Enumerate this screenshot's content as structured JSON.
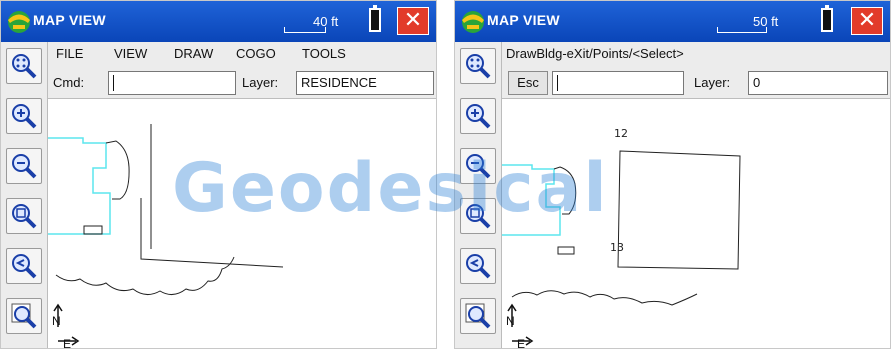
{
  "left": {
    "title": "MAP VIEW",
    "scale": "40 ft",
    "close_label": "✕",
    "menu": [
      "FILE",
      "VIEW",
      "DRAW",
      "COGO",
      "TOOLS"
    ],
    "cmd_label": "Cmd:",
    "cmd_value": "",
    "layer_label": "Layer:",
    "layer_value": "RESIDENCE"
  },
  "right": {
    "title": "MAP VIEW",
    "scale": "50 ft",
    "close_label": "✕",
    "prompt": "DrawBldg-eXit/Points/<Select>",
    "esc_label": "Esc",
    "cmd_value": "",
    "layer_label": "Layer:",
    "layer_value": "0",
    "point_labels": [
      "12",
      "13"
    ]
  },
  "watermark": "Geodesical",
  "colors": {
    "titlebar": "#1a56c8",
    "close": "#e23b2a",
    "boundary": "#5ce6ee",
    "linework": "#222222",
    "watermark": "#2b7fd6"
  },
  "icons": [
    "app-logo-icon",
    "zoom-extents-icon",
    "zoom-in-icon",
    "zoom-out-icon",
    "zoom-window-icon",
    "zoom-previous-icon",
    "zoom-realtime-icon",
    "north-arrow-icon",
    "battery-icon",
    "close-icon"
  ]
}
